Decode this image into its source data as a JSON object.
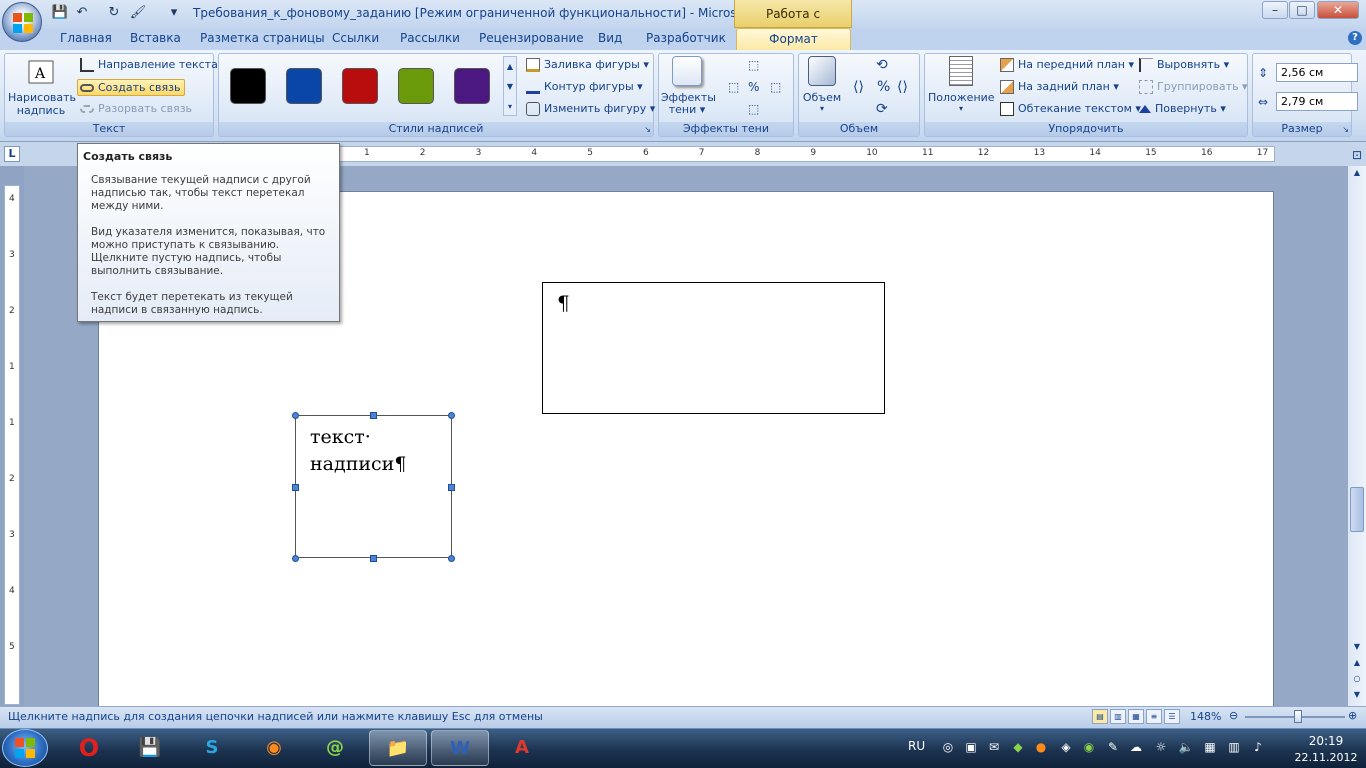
{
  "window": {
    "title": "Требования_к_фоновому_заданию [Режим ограниченной функциональности] - Microsoft W...",
    "context_tab": "Работа с надписями",
    "controls": {
      "minimize": "–",
      "maximize": "□",
      "close": "✕"
    }
  },
  "quick_access": {
    "save": "💾",
    "undo": "↶",
    "redo": "↻",
    "format_painter": "🖌",
    "customize": "▾"
  },
  "tabs": [
    "Главная",
    "Вставка",
    "Разметка страницы",
    "Ссылки",
    "Рассылки",
    "Рецензирование",
    "Вид",
    "Разработчик"
  ],
  "active_tab": "Формат",
  "help": "?",
  "ribbon": {
    "text_group": {
      "label": "Текст",
      "draw_textbox": "Нарисовать надпись",
      "text_direction": "Направление текста",
      "create_link": "Создать связь",
      "break_link": "Разорвать связь"
    },
    "styles_group": {
      "label": "Стили надписей",
      "swatches": [
        "#000000",
        "#0a46a8",
        "#b80d0d",
        "#6a9a0a",
        "#4a1880"
      ],
      "fill": "Заливка фигуры",
      "outline": "Контур фигуры",
      "change_shape": "Изменить фигуру"
    },
    "shadow_group": {
      "label": "Эффекты тени",
      "effects_line1": "Эффекты",
      "effects_line2": "тени"
    },
    "volume_group": {
      "label": "Объем",
      "volume": "Объем"
    },
    "arrange_group": {
      "label": "Упорядочить",
      "position": "Положение",
      "bring_front": "На передний план",
      "send_back": "На задний план",
      "wrap": "Обтекание текстом",
      "align": "Выровнять",
      "group": "Группировать",
      "rotate": "Повернуть"
    },
    "size_group": {
      "label": "Размер",
      "height": "2,56 см",
      "width": "2,79 см"
    }
  },
  "ruler": {
    "h_numbers": [
      "1",
      "2",
      "3",
      "4",
      "5",
      "6",
      "7",
      "8",
      "9",
      "10",
      "11",
      "12",
      "13",
      "14",
      "15",
      "16",
      "17"
    ],
    "v_numbers": [
      "4",
      "3",
      "2",
      "1",
      "1",
      "2",
      "3",
      "4",
      "5"
    ],
    "corner": "L"
  },
  "tooltip": {
    "title": "Создать связь",
    "p1": "Связывание текущей надписи с другой надписью так, чтобы текст перетекал между ними.",
    "p2": "Вид указателя изменится, показывая, что можно приступать к связыванию. Щелкните пустую надпись, чтобы выполнить связывание.",
    "p3": "Текст будет перетекать из текущей надписи в связанную надпись."
  },
  "document": {
    "textbox_empty_mark": "¶",
    "textbox_text_line1": "текст·",
    "textbox_text_line2": "надписи¶"
  },
  "statusbar": {
    "message": "Щелкните надпись для создания цепочки надписей или нажмите клавишу Esc для отмены",
    "zoom": "148%"
  },
  "taskbar": {
    "language": "RU",
    "time": "20:19",
    "date": "22.11.2012"
  }
}
